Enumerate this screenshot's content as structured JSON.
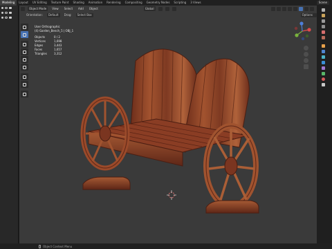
{
  "topbar": {
    "tabs": [
      "Modeling",
      "Layout",
      "UV Editing",
      "Texture Paint",
      "Shading",
      "Animation",
      "Rendering",
      "Compositing",
      "Geometry Nodes",
      "Scripting",
      "3 Views"
    ],
    "active_tab": "Modeling",
    "scene": "Scene"
  },
  "viewport_header": {
    "mode": "Object Mode",
    "menus": [
      "View",
      "Select",
      "Add",
      "Object"
    ],
    "transform": "Global"
  },
  "viewport_header2": {
    "orientation_label": "Orientation:",
    "orientation_value": "Default",
    "drag_label": "Drag:",
    "drag_value": "Select Box",
    "options": "Options"
  },
  "stats": {
    "view": "User Orthographic",
    "object_path": "(4) Garden_Bench_5 | OBJ_1",
    "rows": [
      {
        "k": "Objects",
        "v": "0 / 2"
      },
      {
        "k": "Vertices",
        "v": "1,698"
      },
      {
        "k": "Edges",
        "v": "3,443"
      },
      {
        "k": "Faces",
        "v": "1,657"
      },
      {
        "k": "Triangles",
        "v": "3,312"
      }
    ]
  },
  "status": {
    "hint": "Object Context Menu"
  },
  "colors": {
    "viewport_bg": "#3a3a3a",
    "accent": "#4772b3",
    "wood": "#8a3d24"
  }
}
